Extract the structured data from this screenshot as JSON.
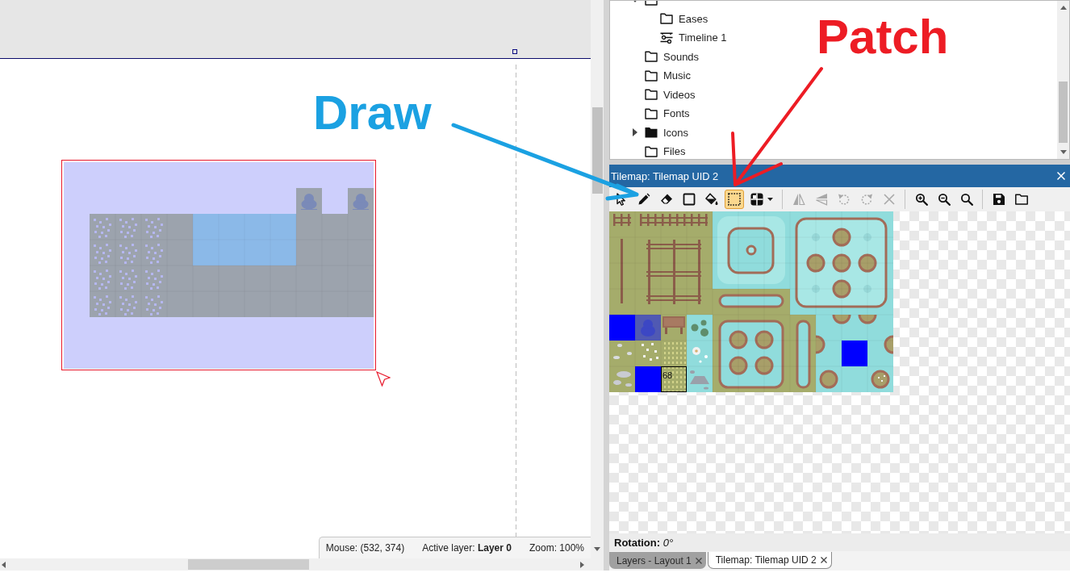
{
  "layout_view": {
    "status_bar": {
      "mouse": "Mouse: (532, 374)",
      "active_layer": "Active layer: **Layer 0**",
      "zoom": "Zoom: 100%"
    }
  },
  "project_tree": {
    "items": [
      {
        "kind": "folder",
        "expanded": true,
        "children": [
          {
            "label": "Eases",
            "kind": "folder",
            "expanded": false
          },
          {
            "label": "Timeline 1",
            "kind": "timeline",
            "expanded": false
          }
        ]
      },
      {
        "label": "Sounds",
        "kind": "folder",
        "expanded": false
      },
      {
        "label": "Music",
        "kind": "folder",
        "expanded": false
      },
      {
        "label": "Videos",
        "kind": "folder",
        "expanded": false
      },
      {
        "label": "Fonts",
        "kind": "folder",
        "expanded": false
      },
      {
        "label": "Icons",
        "kind": "folder-with-items",
        "expanded": false
      },
      {
        "label": "Files",
        "kind": "folder",
        "expanded": false
      }
    ]
  },
  "tilemap_panel": {
    "title": "Tilemap: Tilemap UID 2",
    "tool_groups": [
      [
        {
          "kind": "select",
          "selected": false,
          "disabled": false,
          "dropdown": false
        },
        {
          "kind": "pencil",
          "selected": false,
          "disabled": false,
          "dropdown": false
        },
        {
          "kind": "eraser",
          "selected": false,
          "disabled": false,
          "dropdown": false
        },
        {
          "kind": "rectangle",
          "selected": false,
          "disabled": false,
          "dropdown": false
        },
        {
          "kind": "fill",
          "selected": false,
          "disabled": false,
          "dropdown": false
        },
        {
          "kind": "patch",
          "selected": true,
          "disabled": false,
          "dropdown": false
        },
        {
          "kind": "grid",
          "selected": false,
          "disabled": false,
          "dropdown": true
        }
      ],
      [
        {
          "kind": "flip-horizontal",
          "selected": false,
          "disabled": true,
          "dropdown": false
        },
        {
          "kind": "flip-vertical",
          "selected": false,
          "disabled": true,
          "dropdown": false
        },
        {
          "kind": "rotate-left",
          "selected": false,
          "disabled": true,
          "dropdown": false
        },
        {
          "kind": "rotate-right",
          "selected": false,
          "disabled": true,
          "dropdown": false
        },
        {
          "kind": "delete",
          "selected": false,
          "disabled": true,
          "dropdown": false
        }
      ],
      [
        {
          "kind": "zoom-in",
          "selected": false,
          "disabled": false,
          "dropdown": false
        },
        {
          "kind": "zoom-out",
          "selected": false,
          "disabled": false,
          "dropdown": false
        },
        {
          "kind": "zoom-reset",
          "selected": false,
          "disabled": false,
          "dropdown": false
        }
      ],
      [
        {
          "kind": "save",
          "selected": false,
          "disabled": false,
          "dropdown": false
        },
        {
          "kind": "open",
          "selected": false,
          "disabled": false,
          "dropdown": false
        }
      ]
    ],
    "selected_tile": "68",
    "rotation": "**Rotation:** *0°*"
  },
  "bottom_tabs": [
    {
      "label": "Layers - Layout 1",
      "selected": false
    },
    {
      "label": "Tilemap: Tilemap UID 2",
      "selected": true
    }
  ],
  "annotations": [
    {
      "text": "Draw",
      "color": "#1ba1e2"
    },
    {
      "text": "Patch",
      "color": "#ed1c24"
    }
  ]
}
